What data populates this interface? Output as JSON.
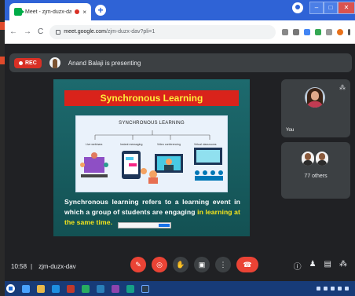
{
  "browser": {
    "tab_title": "Meet - zjm-duzx-dav",
    "new_tab_symbol": "+",
    "window_controls": [
      "–",
      "□",
      "✕"
    ],
    "nav_symbols": [
      "←",
      "→",
      "C"
    ],
    "url_host": "meet.google.com",
    "url_path": "/zjm-duzx-dav?pli=1"
  },
  "meet": {
    "rec_label": "REC",
    "presenting_text": "Anand Balaji is presenting",
    "time": "10:58",
    "meeting_code": "zjm-duzx-dav",
    "tiles": {
      "you_label": "You",
      "others_label": "77 others"
    },
    "controls": [
      "mic-off",
      "camera-off",
      "raise-hand",
      "present",
      "more",
      "end-call"
    ]
  },
  "slide": {
    "title": "Synchronous Learning",
    "figure_title": "SYNCHRONOUS LEARNING",
    "figure_labels": [
      "Live webinars",
      "Instant messaging",
      "Video conferencing",
      "Virtual classrooms"
    ],
    "body_main": "Synchronous learning refers to a learning event in which a group of students are engaging ",
    "body_highlight": "in learning at the same time."
  },
  "colors": {
    "meet_bg": "#202124",
    "slide_bg": "#1d6a6e",
    "slide_title_bg": "#d9231b",
    "slide_title_text": "#ffef3a",
    "highlight": "#f8e71c",
    "end_call": "#ea4335",
    "taskbar": "#173b78"
  }
}
